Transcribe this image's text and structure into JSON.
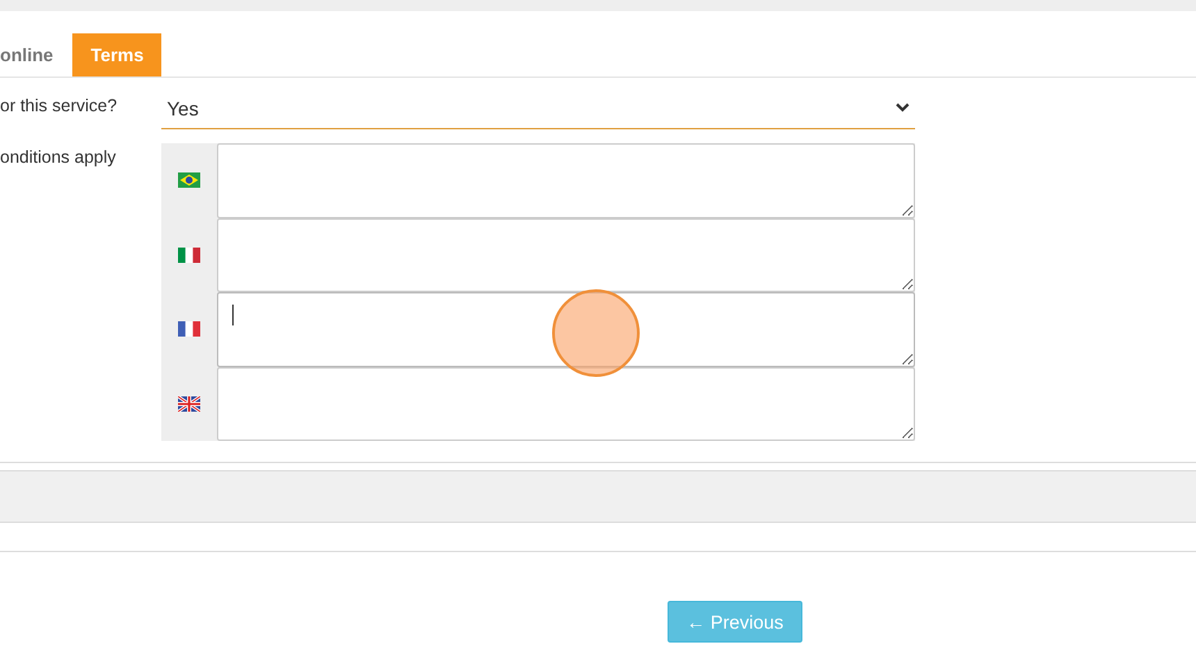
{
  "tabs": [
    {
      "label": "online",
      "selected": false
    },
    {
      "label": "Terms",
      "selected": true
    }
  ],
  "fields": [
    {
      "label": "or this service?",
      "value": "Yes"
    },
    {
      "label": "onditions apply"
    }
  ],
  "translations": [
    {
      "kind": "br",
      "focused": false
    },
    {
      "kind": "it",
      "focused": false
    },
    {
      "kind": "fr",
      "focused": true
    },
    {
      "kind": "gb",
      "focused": false
    }
  ],
  "click_indicator": true,
  "buttons": [
    {
      "label": "← Previous"
    }
  ]
}
